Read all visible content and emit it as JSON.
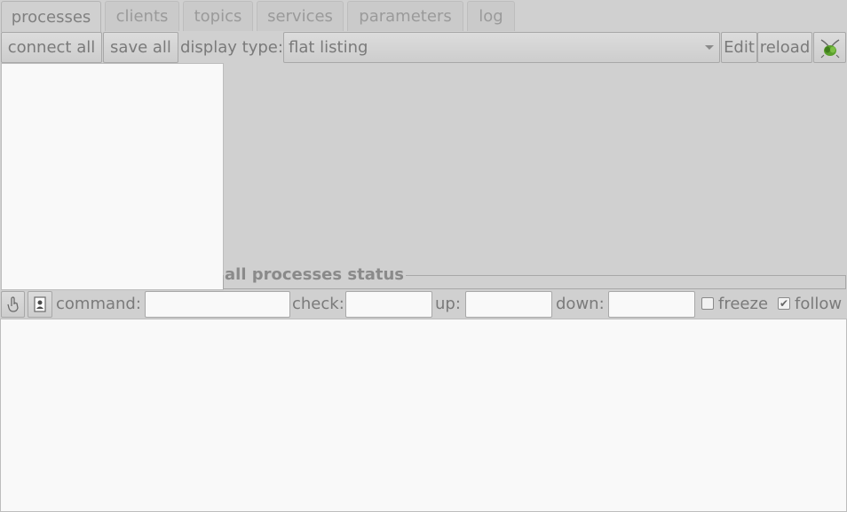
{
  "tabs": [
    {
      "label": "processes",
      "active": true
    },
    {
      "label": "clients",
      "active": false
    },
    {
      "label": "topics",
      "active": false
    },
    {
      "label": "services",
      "active": false
    },
    {
      "label": "parameters",
      "active": false
    },
    {
      "label": "log",
      "active": false
    }
  ],
  "toolbar": {
    "connect_all": "connect all",
    "save_all": "save all",
    "display_type_label": "display type:",
    "display_type_value": "flat listing",
    "edit": "Edit",
    "reload": "reload",
    "logo_icon": "bug-logo-icon"
  },
  "status_group": {
    "title": "all processes status"
  },
  "log_toolbar": {
    "tool_icon_1": "hand-pointer-icon",
    "tool_icon_2": "document-icon",
    "command_label": "command:",
    "command_value": "",
    "check_label": "check:",
    "check_value": "",
    "up_label": "up:",
    "up_value": "",
    "down_label": "down:",
    "down_value": "",
    "freeze_label": "freeze",
    "freeze_checked": false,
    "follow_label": "follow",
    "follow_checked": true
  },
  "colors": {
    "background": "#d0d0d0",
    "panel": "#f9f9f9",
    "text": "#7a7a7a",
    "logo_green": "#5aa02c"
  }
}
